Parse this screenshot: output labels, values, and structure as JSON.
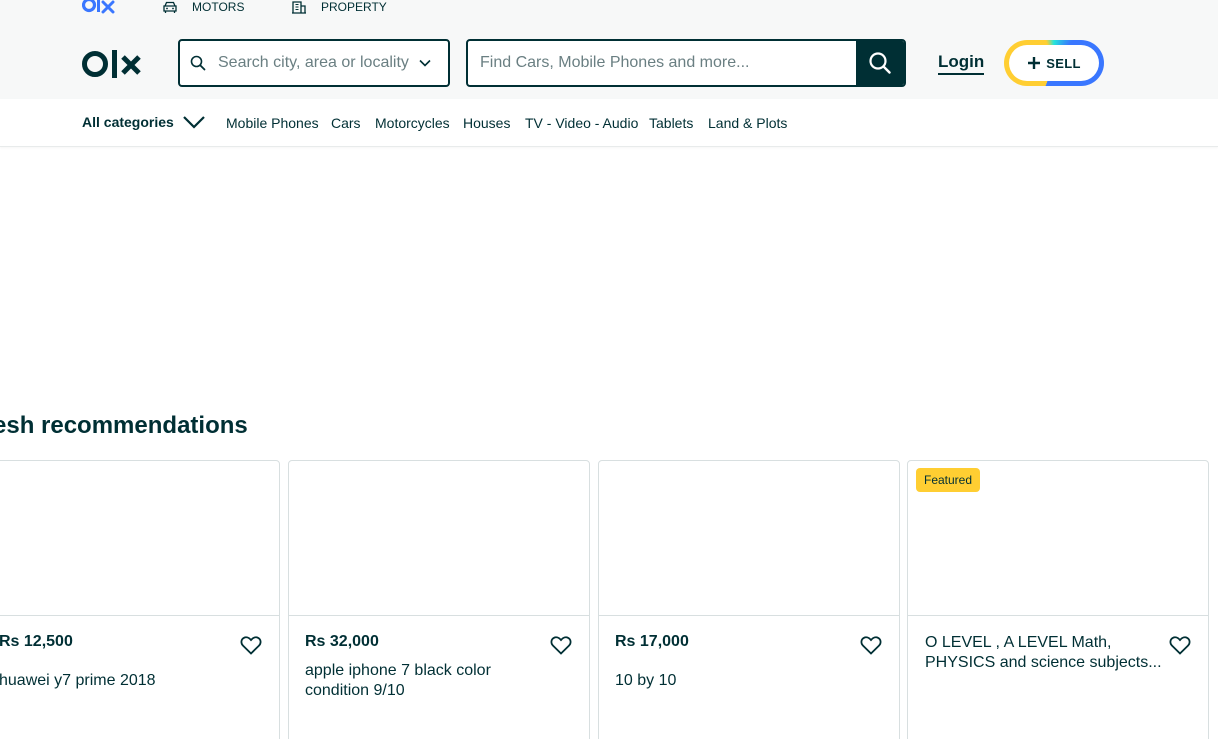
{
  "top_links": {
    "motors": "MOTORS",
    "property": "PROPERTY"
  },
  "header": {
    "location_placeholder": "Search city, area or locality",
    "search_placeholder": "Find Cars, Mobile Phones and more...",
    "login_label": "Login",
    "sell_label": "SELL"
  },
  "categories": {
    "all_label": "All categories",
    "items": [
      "Mobile Phones",
      "Cars",
      "Motorcycles",
      "Houses",
      "TV - Video - Audio",
      "Tablets",
      "Land & Plots"
    ]
  },
  "section": {
    "title": "esh recommendations"
  },
  "cards": [
    {
      "price": "Rs 12,500",
      "title": "huawei y7 prime 2018"
    },
    {
      "price": "Rs 32,000",
      "title": "apple iphone 7 black color condition 9/10"
    },
    {
      "price": "Rs 17,000",
      "title": "10 by 10"
    },
    {
      "badge": "Featured",
      "title": "O LEVEL , A LEVEL Math, PHYSICS and science subjects..."
    }
  ],
  "colors": {
    "brand_dark": "#002f34",
    "featured_badge": "#ffce32",
    "sell_yellow": "#ffce32",
    "sell_blue": "#3a77ff",
    "logo_blue": "#3a77ff"
  },
  "icons": [
    "olx-logo",
    "car-icon",
    "building-icon",
    "search-icon",
    "chevron-down-icon",
    "plus-icon",
    "heart-icon"
  ]
}
